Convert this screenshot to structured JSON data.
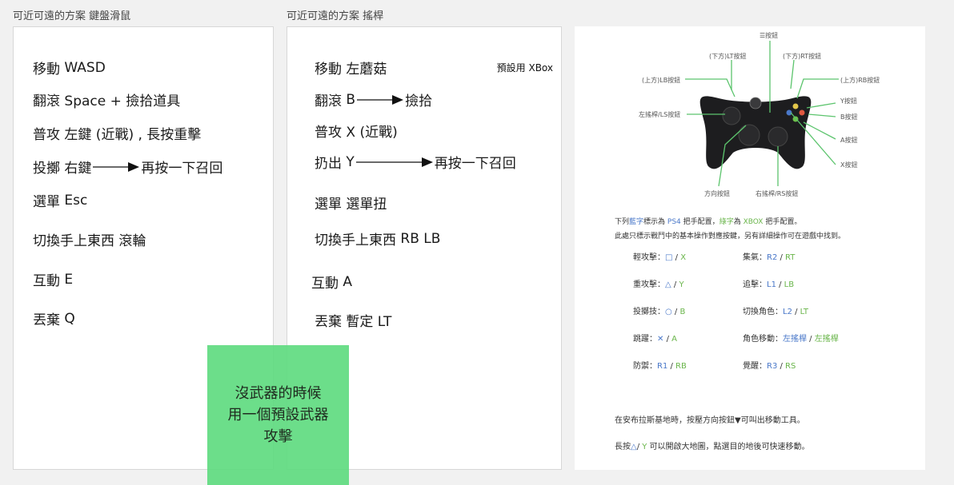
{
  "keyboard_panel": {
    "title": "可近可遠的方案 鍵盤滑鼠",
    "rows": [
      {
        "action": "移動",
        "key": "WASD"
      },
      {
        "action": "翻滾",
        "key": "Space + 撿拾道具"
      },
      {
        "action": "普攻",
        "key": "左鍵 (近戰) , 長按重擊"
      },
      {
        "action": "投擲",
        "key": "右鍵",
        "then": "再按一下召回"
      },
      {
        "action": "選單",
        "key": "Esc"
      },
      {
        "action": "切換手上東西",
        "key": "滾輪"
      },
      {
        "action": "互動",
        "key": "E"
      },
      {
        "action": "丟棄",
        "key": "Q"
      }
    ]
  },
  "gamepad_panel": {
    "title": "可近可遠的方案 搖桿",
    "preset_tag": "預設用 XBox",
    "rows": [
      {
        "action": "移動",
        "key": "左蘑菇"
      },
      {
        "action": "翻滾",
        "key": "B",
        "then": "撿拾"
      },
      {
        "action": "普攻",
        "key": "X (近戰)"
      },
      {
        "action": "扔出",
        "key": "Y",
        "then": "再按一下召回"
      },
      {
        "action": "選單",
        "key": "選單扭"
      },
      {
        "action": "切換手上東西",
        "key": "RB LB"
      },
      {
        "action": "互動",
        "key": "A"
      },
      {
        "action": "丟棄",
        "key": "暫定 LT"
      }
    ]
  },
  "sticky_note": {
    "lines": [
      "沒武器的時候",
      "用一個預設武器",
      "攻擊"
    ],
    "color": "#60db80"
  },
  "controller_reference": {
    "labels": {
      "menu": "☰按鈕",
      "lt": "(下方)LT按鈕",
      "rt": "(下方)RT按鈕",
      "lb": "(上方)LB按鈕",
      "rb": "(上方)RB按鈕",
      "ls": "左搖桿/LS按鈕",
      "y": "Y按鈕",
      "b": "B按鈕",
      "a": "A按鈕",
      "x": "X按鈕",
      "dpad": "方向按鈕",
      "rs": "右搖桿/RS按鈕"
    },
    "intro_line1": {
      "a": "下列",
      "b": "藍字",
      "c": "標示為",
      "d": "PS4",
      "e": "把手配置，",
      "f": "綠字",
      "g": "為",
      "h": "XBOX",
      "i": "把手配置。"
    },
    "intro_line2": "此處只標示戰鬥中的基本操作對應按鍵，另有詳細操作可在遊戲中找到。",
    "mappings": [
      {
        "name": "輕攻擊：",
        "ps": "□",
        "xb": "X"
      },
      {
        "name": "集氣：",
        "ps": "R2",
        "xb": "RT"
      },
      {
        "name": "重攻擊：",
        "ps": "△",
        "xb": "Y"
      },
      {
        "name": "追擊：",
        "ps": "L1",
        "xb": "LB"
      },
      {
        "name": "投擲技：",
        "ps": "○",
        "xb": "B"
      },
      {
        "name": "切換角色：",
        "ps": "L2",
        "xb": "LT"
      },
      {
        "name": "跳躍：",
        "ps": "✕",
        "xb": "A"
      },
      {
        "name": "角色移動：",
        "ps": "左搖桿",
        "xb": "左搖桿"
      },
      {
        "name": "防禦：",
        "ps": "R1",
        "xb": "RB"
      },
      {
        "name": "覺醒：",
        "ps": "R3",
        "xb": "RS"
      }
    ],
    "footer1": "在安布拉斯基地時，按壓方向按鈕▼可叫出移動工具。",
    "footer2": {
      "a": "長按",
      "ps": "△",
      "sep": "/ ",
      "xb": "Y",
      "b": " 可以開啟大地圖，點選目的地後可快速移動。"
    }
  }
}
